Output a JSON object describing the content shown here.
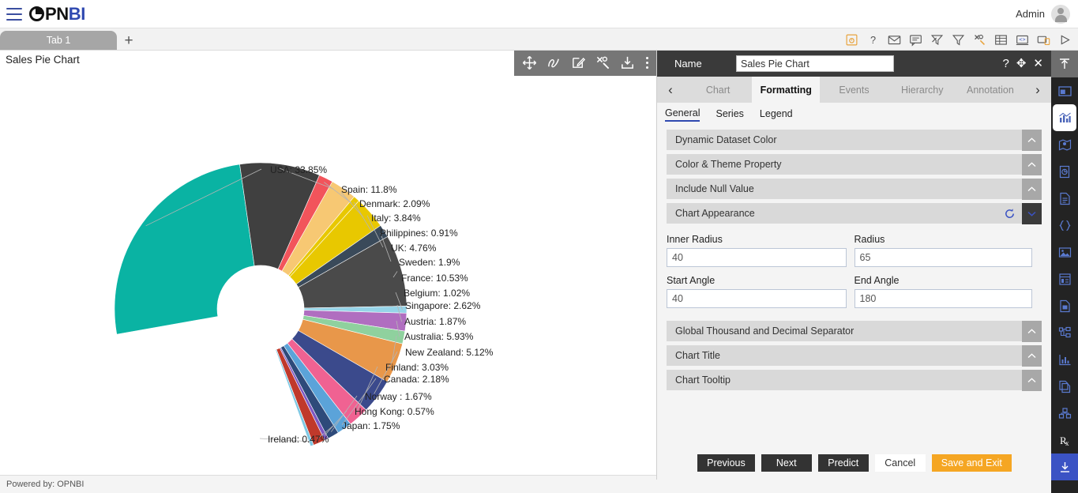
{
  "app": {
    "brand_o": "O",
    "brand_pn": "PN",
    "brand_bi": "BI",
    "user_label": "Admin",
    "footer_text": "Powered by: OPNBI"
  },
  "tabs": {
    "items": [
      {
        "label": "Tab 1"
      }
    ],
    "add_label": "+"
  },
  "top_icons": [
    {
      "name": "save-icon"
    },
    {
      "name": "help-icon"
    },
    {
      "name": "mail-icon"
    },
    {
      "name": "comment-icon"
    },
    {
      "name": "clear-filter-icon"
    },
    {
      "name": "filter-icon"
    },
    {
      "name": "tools-icon"
    },
    {
      "name": "table-icon"
    },
    {
      "name": "code-icon"
    },
    {
      "name": "device-icon"
    },
    {
      "name": "play-icon"
    }
  ],
  "canvas": {
    "widget_title": "Sales Pie Chart",
    "toolbar": [
      {
        "name": "move-icon"
      },
      {
        "name": "scribble-icon"
      },
      {
        "name": "edit-icon"
      },
      {
        "name": "tools-icon"
      },
      {
        "name": "download-icon"
      },
      {
        "name": "kebab-menu-icon"
      }
    ]
  },
  "panel": {
    "name_label": "Name",
    "name_value": "Sales Pie Chart",
    "head_icons": {
      "help": "?",
      "move": "✥",
      "close": "✕"
    },
    "prev_arrow": "‹",
    "next_arrow": "›",
    "main_tabs": [
      {
        "label": "Chart",
        "active": false
      },
      {
        "label": "Formatting",
        "active": true
      },
      {
        "label": "Events",
        "active": false
      },
      {
        "label": "Hierarchy",
        "active": false
      },
      {
        "label": "Annotation",
        "active": false
      }
    ],
    "sub_tabs": [
      {
        "label": "General",
        "active": true
      },
      {
        "label": "Series",
        "active": false
      },
      {
        "label": "Legend",
        "active": false
      }
    ],
    "sections": [
      {
        "title": "Dynamic Dataset Color",
        "open": false
      },
      {
        "title": "Color & Theme Property",
        "open": false
      },
      {
        "title": "Include Null Value",
        "open": false
      },
      {
        "title": "Chart Appearance",
        "open": true
      }
    ],
    "sections_bottom": [
      {
        "title": "Global Thousand and Decimal Separator",
        "open": false
      },
      {
        "title": "Chart Title",
        "open": false
      },
      {
        "title": "Chart Tooltip",
        "open": false
      }
    ],
    "appearance": {
      "inner_radius_label": "Inner Radius",
      "inner_radius_value": "40",
      "radius_label": "Radius",
      "radius_value": "65",
      "start_angle_label": "Start Angle",
      "start_angle_value": "40",
      "end_angle_label": "End Angle",
      "end_angle_value": "180"
    },
    "buttons": {
      "previous": "Previous",
      "next": "Next",
      "predict": "Predict",
      "cancel": "Cancel",
      "save_exit": "Save and Exit"
    }
  },
  "rail": [
    {
      "name": "collapse-up-icon"
    },
    {
      "name": "layout-icon"
    },
    {
      "name": "chart-icon"
    },
    {
      "name": "map-icon"
    },
    {
      "name": "dataset-icon"
    },
    {
      "name": "document-icon"
    },
    {
      "name": "json-icon"
    },
    {
      "name": "image-icon"
    },
    {
      "name": "form-icon"
    },
    {
      "name": "report-icon"
    },
    {
      "name": "tree-icon"
    },
    {
      "name": "bar-icon"
    },
    {
      "name": "copy-icon"
    },
    {
      "name": "cube-icon"
    },
    {
      "name": "prescription-icon"
    },
    {
      "name": "download-icon"
    }
  ],
  "chart_data": {
    "type": "pie",
    "title": "Sales Pie Chart",
    "variant": "donut-arc",
    "inner_radius": 40,
    "radius": 65,
    "start_angle": 40,
    "end_angle": 180,
    "labels_show_percent": true,
    "categories": [
      "USA",
      "Spain",
      "Denmark",
      "Italy",
      "Philippines",
      "UK",
      "Sweden",
      "France",
      "Belgium",
      "Singapore",
      "Austria",
      "Australia",
      "New Zealand",
      "Finland",
      "Canada",
      "Norway ",
      "Hong Kong",
      "Japan",
      "Ireland"
    ],
    "values": [
      33.85,
      11.8,
      2.09,
      3.84,
      0.91,
      4.76,
      1.9,
      10.53,
      1.02,
      2.62,
      1.87,
      5.93,
      5.12,
      3.03,
      2.18,
      1.67,
      0.57,
      1.75,
      0.47
    ],
    "unit": "%",
    "colors": [
      "#0ab3a3",
      "#404040",
      "#f2545b",
      "#f7c873",
      "#e8c800",
      "#e8c800",
      "#3a4a5a",
      "#4a4a4a",
      "#96d4e8",
      "#b06ec0",
      "#8fd19e",
      "#e8974a",
      "#3b4a8c",
      "#f06292",
      "#5ba3d9",
      "#2e4a7a",
      "#7e57c2",
      "#c0392b",
      "#7ec8e3"
    ],
    "data_labels": [
      "USA: 33.85%",
      "Spain: 11.8%",
      "Denmark: 2.09%",
      "Italy: 3.84%",
      "Philippines: 0.91%",
      "UK: 4.76%",
      "Sweden: 1.9%",
      "France: 10.53%",
      "Belgium: 1.02%",
      "Singapore: 2.62%",
      "Austria: 1.87%",
      "Australia: 5.93%",
      "New Zealand: 5.12%",
      "Finland: 3.03%",
      "Canada: 2.18%",
      "Norway : 1.67%",
      "Hong Kong: 0.57%",
      "Japan: 1.75%",
      "Ireland: 0.47%"
    ]
  }
}
